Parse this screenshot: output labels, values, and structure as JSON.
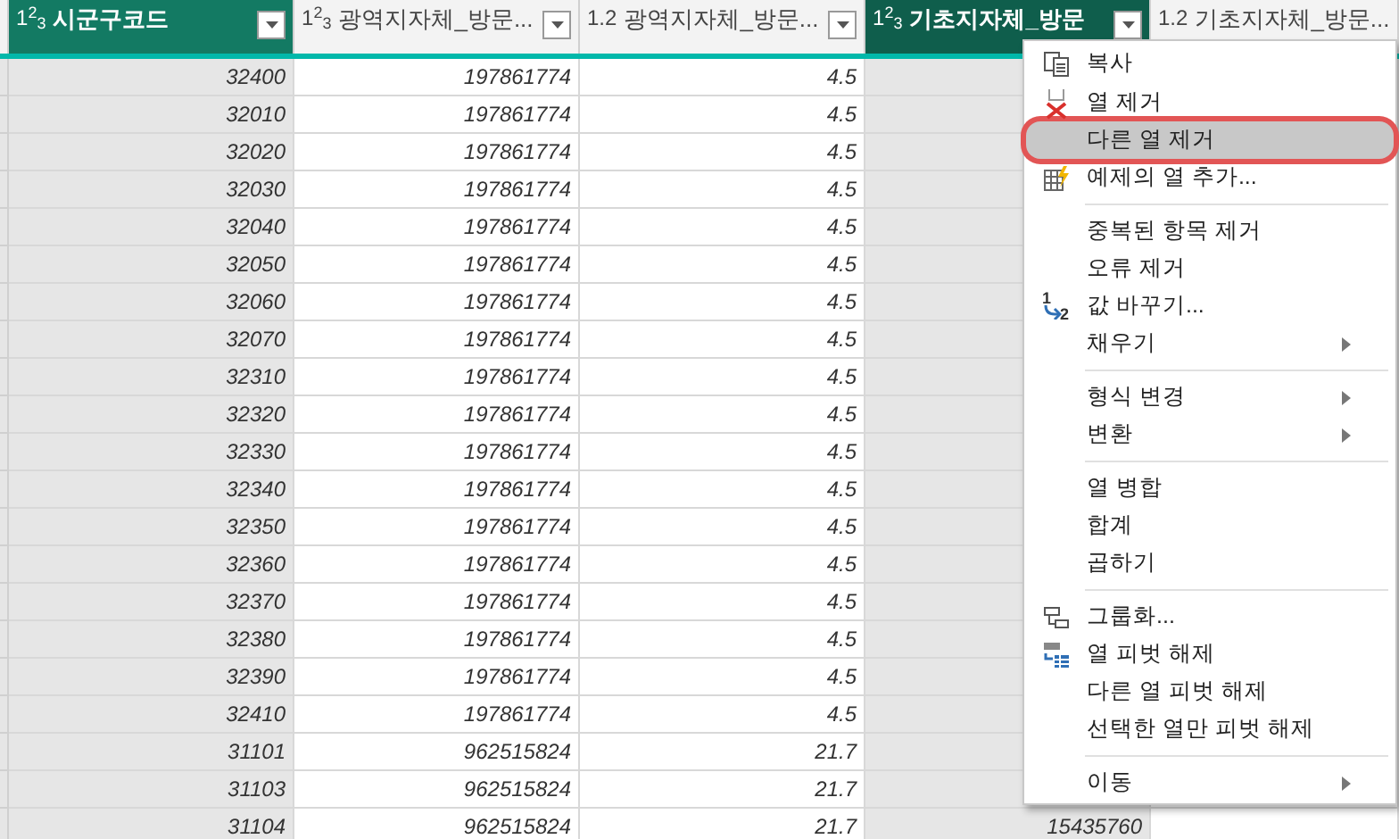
{
  "columns": [
    {
      "type": "1$^{2}$$_{3}$",
      "title": "시군구코드",
      "selected": true,
      "filter": true
    },
    {
      "type": "1$^{2}$$_{3}$",
      "title": "광역지자체_방문...",
      "selected": false,
      "filter": true
    },
    {
      "type": "1.2",
      "title": "광역지자체_방문...",
      "selected": false,
      "filter": true
    },
    {
      "type": "1$^{2}$$_{3}$",
      "title": "기초지자체_방문",
      "selected": true,
      "filter": true
    },
    {
      "type": "1.2",
      "title": "기초지자체_방문...",
      "selected": false,
      "filter": false
    }
  ],
  "rows": [
    [
      "32400",
      "197861774",
      "4.5"
    ],
    [
      "32010",
      "197861774",
      "4.5"
    ],
    [
      "32020",
      "197861774",
      "4.5"
    ],
    [
      "32030",
      "197861774",
      "4.5"
    ],
    [
      "32040",
      "197861774",
      "4.5"
    ],
    [
      "32050",
      "197861774",
      "4.5"
    ],
    [
      "32060",
      "197861774",
      "4.5"
    ],
    [
      "32070",
      "197861774",
      "4.5"
    ],
    [
      "32310",
      "197861774",
      "4.5"
    ],
    [
      "32320",
      "197861774",
      "4.5"
    ],
    [
      "32330",
      "197861774",
      "4.5"
    ],
    [
      "32340",
      "197861774",
      "4.5"
    ],
    [
      "32350",
      "197861774",
      "4.5"
    ],
    [
      "32360",
      "197861774",
      "4.5"
    ],
    [
      "32370",
      "197861774",
      "4.5"
    ],
    [
      "32380",
      "197861774",
      "4.5"
    ],
    [
      "32390",
      "197861774",
      "4.5"
    ],
    [
      "32410",
      "197861774",
      "4.5"
    ],
    [
      "31101",
      "962515824",
      "21.7"
    ],
    [
      "31103",
      "962515824",
      "21.7"
    ],
    [
      "31104",
      "962515824",
      "21.7",
      "15435760"
    ]
  ],
  "context_menu": [
    {
      "kind": "item",
      "label": "복사",
      "highlighted": false
    },
    {
      "kind": "item",
      "label": "열 제거",
      "highlighted": false
    },
    {
      "kind": "item",
      "label": "다른 열 제거",
      "highlighted": true
    },
    {
      "kind": "item",
      "label": "예제의 열 추가...",
      "highlighted": false
    },
    {
      "kind": "separator"
    },
    {
      "kind": "item",
      "label": "중복된 항목 제거",
      "highlighted": false
    },
    {
      "kind": "item",
      "label": "오류 제거",
      "highlighted": false
    },
    {
      "kind": "item",
      "label": "값 바꾸기...",
      "highlighted": false,
      "icon_labels": [
        "1",
        "2"
      ]
    },
    {
      "kind": "submenu",
      "label": "채우기",
      "highlighted": false
    },
    {
      "kind": "separator"
    },
    {
      "kind": "submenu",
      "label": "형식 변경",
      "highlighted": false
    },
    {
      "kind": "submenu",
      "label": "변환",
      "highlighted": false
    },
    {
      "kind": "separator"
    },
    {
      "kind": "item",
      "label": "열 병합",
      "highlighted": false
    },
    {
      "kind": "item",
      "label": "합계",
      "highlighted": false
    },
    {
      "kind": "item",
      "label": "곱하기",
      "highlighted": false
    },
    {
      "kind": "separator"
    },
    {
      "kind": "item",
      "label": "그룹화...",
      "highlighted": false
    },
    {
      "kind": "item",
      "label": "열 피벗 해제",
      "highlighted": false
    },
    {
      "kind": "item",
      "label": "다른 열 피벗 해제",
      "highlighted": false
    },
    {
      "kind": "item",
      "label": "선택한 열만 피벗 해제",
      "highlighted": false
    },
    {
      "kind": "separator"
    },
    {
      "kind": "submenu",
      "label": "이동",
      "highlighted": false
    }
  ]
}
